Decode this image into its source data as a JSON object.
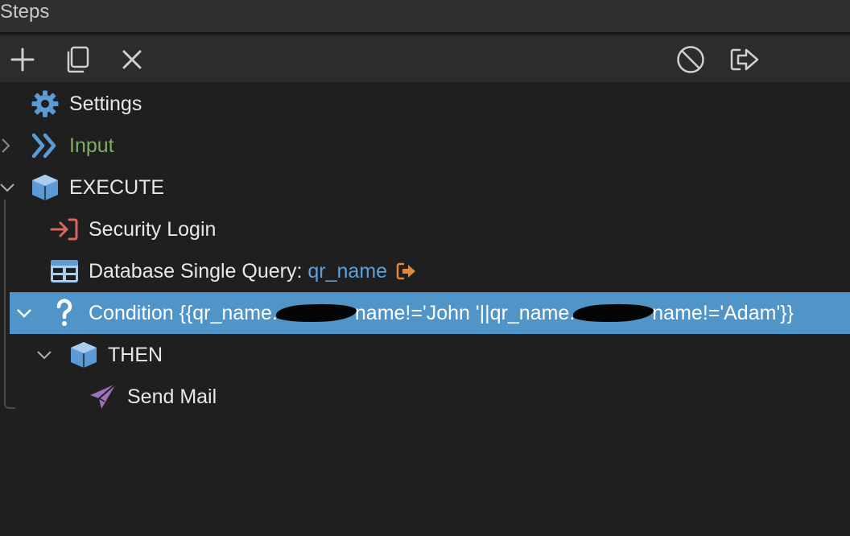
{
  "panel": {
    "title": "Steps"
  },
  "toolbar": {
    "add": "plus-icon",
    "copy": "copy-icon",
    "delete": "close-icon",
    "disable": "disable-icon",
    "export": "export-icon"
  },
  "tree": {
    "settings": {
      "label": "Settings",
      "icon": "gear-icon"
    },
    "input": {
      "label": "Input",
      "icon": "double-chevron-icon"
    },
    "execute": {
      "label": "EXECUTE",
      "icon": "cube-icon"
    },
    "security_login": {
      "label": "Security Login",
      "icon": "login-icon"
    },
    "db_query": {
      "label": "Database Single Query: ",
      "var": "qr_name",
      "icon": "table-icon"
    },
    "condition": {
      "prefix": "Condition {{qr_name.",
      "part1": "name!='John '||qr_name.",
      "part2": "name!='Adam'}}",
      "icon": "question-icon"
    },
    "then": {
      "label": "THEN",
      "icon": "cube-icon"
    },
    "send_mail": {
      "label": "Send Mail",
      "icon": "paper-plane-icon"
    }
  },
  "colors": {
    "selected": "#5094c8",
    "input_label": "#7fae5f",
    "variable": "#5ea0dc",
    "icon_blue": "#5b9bd5",
    "login_icon": "#d9675c",
    "mail_icon": "#a070b8",
    "output_icon": "#e0883a"
  }
}
